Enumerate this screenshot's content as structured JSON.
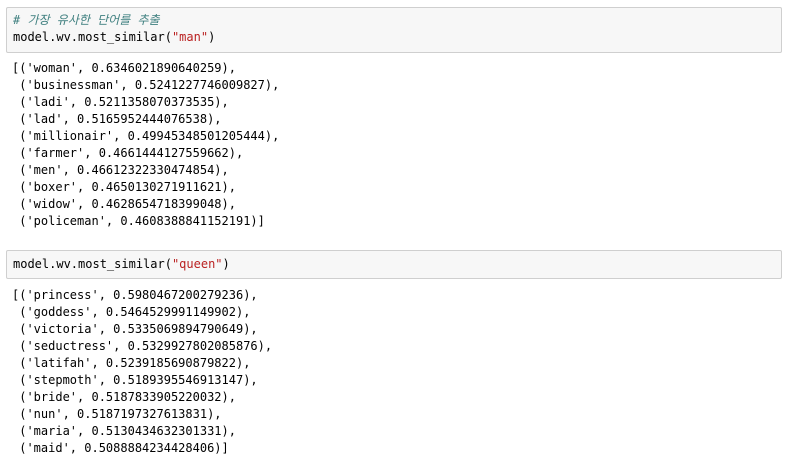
{
  "cells": [
    {
      "input": {
        "comment": "# 가장 유사한 단어를 추출",
        "code_prefix": "model.wv.most_similar(",
        "code_arg": "\"man\"",
        "code_suffix": ")"
      },
      "output": [
        "[('woman', 0.6346021890640259),",
        " ('businessman', 0.5241227746009827),",
        " ('ladi', 0.5211358070373535),",
        " ('lad', 0.5165952444076538),",
        " ('millionair', 0.49945348501205444),",
        " ('farmer', 0.4661444127559662),",
        " ('men', 0.46612322330474854),",
        " ('boxer', 0.4650130271911621),",
        " ('widow', 0.4628654718399048),",
        " ('policeman', 0.4608388841152191)]"
      ]
    },
    {
      "input": {
        "code_prefix": "model.wv.most_similar(",
        "code_arg": "\"queen\"",
        "code_suffix": ")"
      },
      "output": [
        "[('princess', 0.5980467200279236),",
        " ('goddess', 0.5464529991149902),",
        " ('victoria', 0.5335069894790649),",
        " ('seductress', 0.5329927802085876),",
        " ('latifah', 0.5239185690879822),",
        " ('stepmoth', 0.5189395546913147),",
        " ('bride', 0.5187833905220032),",
        " ('nun', 0.5187197327613831),",
        " ('maria', 0.5130434632301331),",
        " ('maid', 0.5088884234428406)]"
      ]
    }
  ]
}
